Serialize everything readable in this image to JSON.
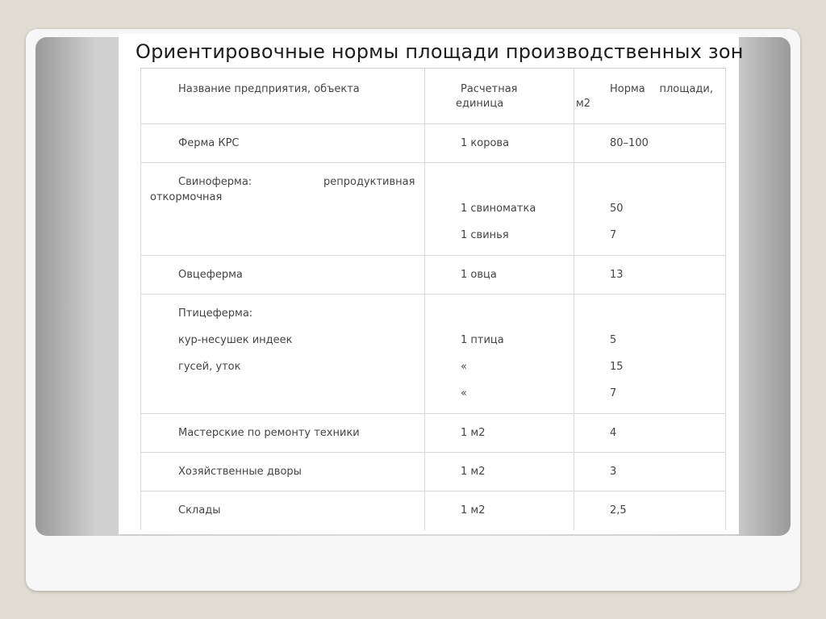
{
  "title": "Ориентировочные нормы площади производственных зон",
  "table": {
    "headers": {
      "name": "Название предприятия, объекта",
      "unit_line1": "Расчетная",
      "unit_line2": "единица",
      "norm_word1": "Норма",
      "norm_word2": "площади,",
      "norm_line2": "м2"
    },
    "rows": [
      {
        "name": "Ферма КРС",
        "unit": "1 корова",
        "norm": "80–100"
      },
      {
        "name_a": "Свиноферма:",
        "name_b": "репродуктивная",
        "name_c": "откормочная",
        "unit_1": "1 свиноматка",
        "unit_2": "1 свинья",
        "norm_1": "50",
        "norm_2": "7"
      },
      {
        "name": "Овцеферма",
        "unit": "1 овца",
        "norm": "13"
      },
      {
        "name_1": "Птицеферма:",
        "name_2": "кур-несушек индеек",
        "name_3": "гусей, уток",
        "unit_1": "1 птица",
        "unit_2": "«",
        "unit_3": "«",
        "norm_1": "5",
        "norm_2": "15",
        "norm_3": "7"
      },
      {
        "name": "Мастерские по ремонту техники",
        "unit": "1 м2",
        "norm": "4"
      },
      {
        "name": "Хозяйственные дворы",
        "unit": "1 м2",
        "norm": "3"
      },
      {
        "name": "Склады",
        "unit": "1 м2",
        "norm": "2,5"
      }
    ]
  }
}
